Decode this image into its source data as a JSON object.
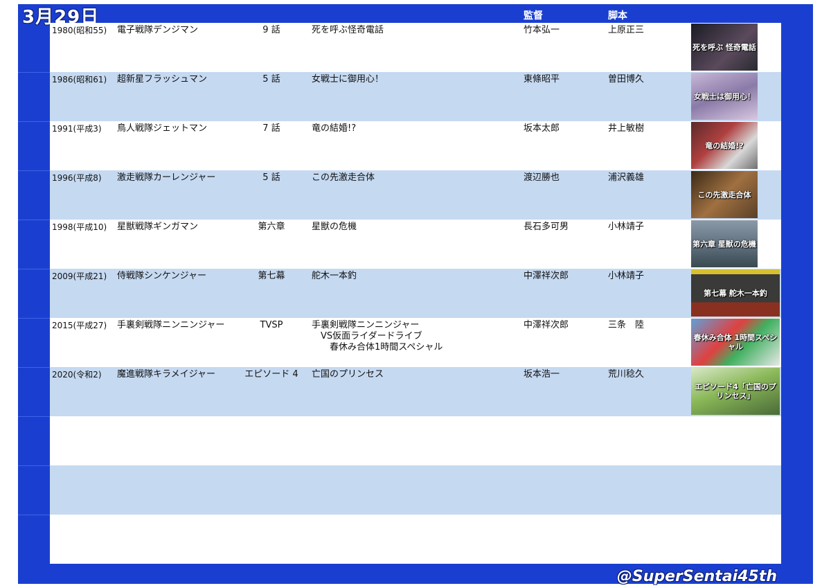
{
  "header": {
    "date": "3月29日",
    "director_label": "監督",
    "writer_label": "脚本",
    "handle": "@SuperSentai45th"
  },
  "rows": [
    {
      "year": "1980(昭和55)",
      "series": "電子戦隊デンジマン",
      "episode": "9 話",
      "title": "死を呼ぶ怪奇電話",
      "director": "竹本弘一",
      "writer": "上原正三",
      "thumb_caption": "死を呼ぶ 怪奇電話"
    },
    {
      "year": "1986(昭和61)",
      "series": "超新星フラッシュマン",
      "episode": "5 話",
      "title": "女戦士に御用心！",
      "director": "東條昭平",
      "writer": "曽田博久",
      "thumb_caption": "女戦士は御用心！"
    },
    {
      "year": "1991(平成3)",
      "series": "鳥人戦隊ジェットマン",
      "episode": "7 話",
      "title": "竜の結婚!?",
      "director": "坂本太郎",
      "writer": "井上敏樹",
      "thumb_caption": "竜の結婚!?"
    },
    {
      "year": "1996(平成8)",
      "series": "激走戦隊カーレンジャー",
      "episode": "5 話",
      "title": "この先激走合体",
      "director": "渡辺勝也",
      "writer": "浦沢義雄",
      "thumb_caption": "この先激走合体"
    },
    {
      "year": "1998(平成10)",
      "series": "星獣戦隊ギンガマン",
      "episode": "第六章",
      "title": "星獣の危機",
      "director": "長石多可男",
      "writer": "小林靖子",
      "thumb_caption": "第六章 星獣の危機"
    },
    {
      "year": "2009(平成21)",
      "series": "侍戦隊シンケンジャー",
      "episode": "第七幕",
      "title": "舵木一本釣",
      "director": "中澤祥次郎",
      "writer": "小林靖子",
      "thumb_caption": "第七幕 舵木一本釣"
    },
    {
      "year": "2015(平成27)",
      "series": "手裏剣戦隊ニンニンジャー",
      "episode": "TVSP",
      "title": "手裏剣戦隊ニンニンジャー",
      "title2": "　VS仮面ライダードライブ",
      "title3": "　　春休み合体1時間スペシャル",
      "director": "中澤祥次郎",
      "writer": "三条　陸",
      "thumb_caption": "春休み合体 1時間スペシャル"
    },
    {
      "year": "2020(令和2)",
      "series": "魔進戦隊キラメイジャー",
      "episode": "エピソード 4",
      "title": "亡国のプリンセス",
      "director": "坂本浩一",
      "writer": "荒川稔久",
      "thumb_caption": "エピソード4「亡国のプリンセス」"
    }
  ],
  "colors": {
    "frame": "#1a3fd0",
    "row_alt": "#c5d9f1"
  }
}
